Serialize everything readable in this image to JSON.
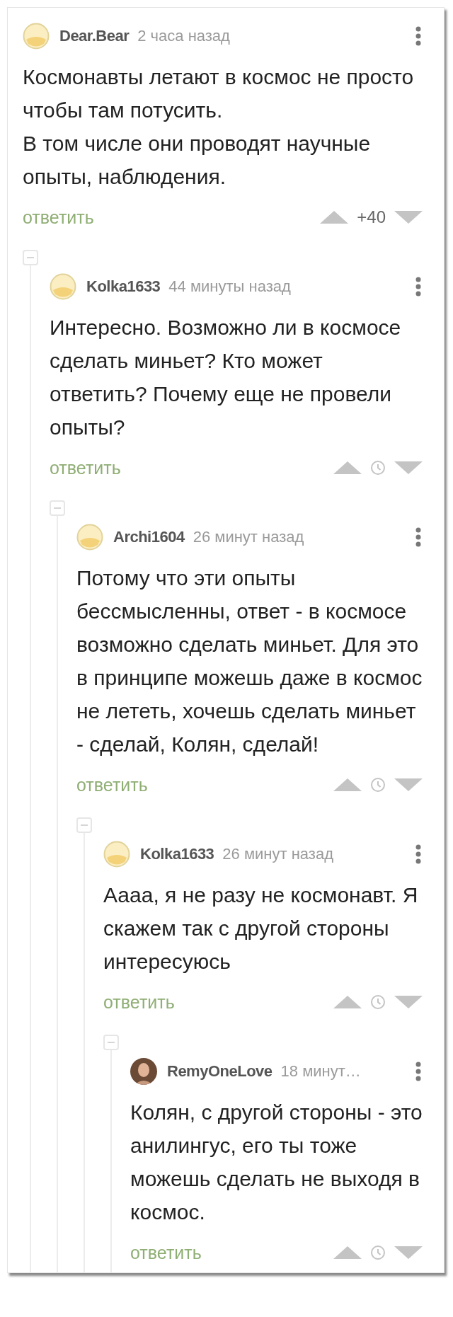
{
  "comments": [
    {
      "author": "Dear.Bear",
      "time": "2 часа назад",
      "avatar": {
        "kind": "default"
      },
      "text": "Космонавты летают в космос не просто чтобы там потусить.\nВ том числе они проводят научные опыты, наблюдения.",
      "reply": "ответить",
      "rating": {
        "kind": "score",
        "text": "+40"
      },
      "children": [
        {
          "author": "Kolka1633",
          "time": "44 минуты назад",
          "avatar": {
            "kind": "default"
          },
          "text": "Интересно. Возможно ли в космосе сделать миньет? Кто может ответить? Почему еще не провели опыты?",
          "reply": "ответить",
          "rating": {
            "kind": "hidden"
          },
          "children": [
            {
              "author": "Archi1604",
              "time": "26 минут назад",
              "avatar": {
                "kind": "default"
              },
              "text": "Потому что эти опыты бессмысленны, ответ - в космосе возможно сделать миньет. Для это в принципе можешь даже в космос не лететь, хочешь сделать миньет - сделай, Колян, сделай!",
              "reply": "ответить",
              "rating": {
                "kind": "hidden"
              },
              "children": [
                {
                  "author": "Kolka1633",
                  "time": "26 минут назад",
                  "avatar": {
                    "kind": "default"
                  },
                  "text": "Аааа, я не разу не космонавт. Я скажем так с другой стороны интересуюсь",
                  "reply": "ответить",
                  "rating": {
                    "kind": "hidden"
                  },
                  "children": [
                    {
                      "author": "RemyOneLove",
                      "time": "18 минут…",
                      "text": "Колян, с другой стороны - это анилингус, его ты тоже можешь сделать не выходя в космос.",
                      "reply": "ответить",
                      "rating": {
                        "kind": "hidden"
                      }
                    }
                  ]
                }
              ]
            }
          ]
        }
      ]
    }
  ]
}
